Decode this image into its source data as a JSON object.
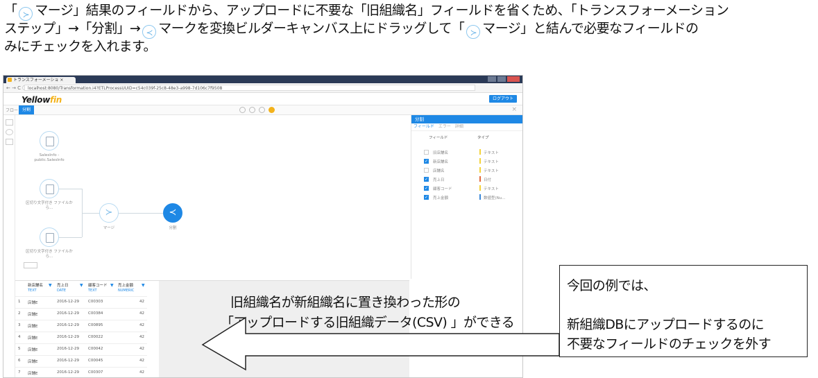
{
  "instruction": {
    "line1_a": "「",
    "line1_b": "マージ」結果のフィールドから、アップロードに不要な「旧組織名」フィールドを省くため、「トランスフォーメーション",
    "line2_a": "ステップ」→「分割」→",
    "line2_b": "マークを変換ビルダーキャンバス上にドラッグして「",
    "line2_c": "マージ」と結んで必要なフィールドの",
    "line3": "みにチェックを入れます。",
    "merge_icon": "merge-icon",
    "split_icon": "split-icon"
  },
  "browser": {
    "tab_title": "トランスフォーメーショ ×",
    "url": "localhost:8080/Transformation.i4?ETLProcessUUID=c54c039f-25c8-48e3-a998-7d106c7f9508",
    "nav_label": "← → C ⓘ"
  },
  "app": {
    "logo_main": "Yellow",
    "logo_fin": "fin",
    "logout_label": "ログアウト",
    "toolbar_tab1": "フロー",
    "toolbar_tab2": "分割",
    "close_glyph": "×"
  },
  "canvas": {
    "nodes": {
      "source1_label": "SalesInfo - public.SalesInfo",
      "source2_label": "区切り文字付き ファイルから...",
      "source3_label": "区切り文字付き ファイルから...",
      "merge_label": "マージ",
      "split_label": "分割"
    }
  },
  "panel": {
    "title": "分割",
    "tabs": [
      "フィールド",
      "エラー",
      "詳細"
    ],
    "col_field": "フィールド",
    "col_type": "タイプ",
    "fields": [
      {
        "name": "旧店舗名",
        "type": "テキスト",
        "checked": false,
        "color": "#f3d33b"
      },
      {
        "name": "新店舗名",
        "type": "テキスト",
        "checked": true,
        "color": "#f3d33b"
      },
      {
        "name": "店舗名",
        "type": "テキスト",
        "checked": false,
        "color": "#f3d33b"
      },
      {
        "name": "売上日",
        "type": "日付",
        "checked": true,
        "color": "#e2683c"
      },
      {
        "name": "顧客コード",
        "type": "テキスト",
        "checked": true,
        "color": "#f3d33b"
      },
      {
        "name": "売上金額",
        "type": "数値型(Nu...",
        "checked": true,
        "color": "#3a87d8"
      }
    ]
  },
  "grid": {
    "headers": [
      {
        "name": "新店舗名",
        "type": "TEXT"
      },
      {
        "name": "売上日",
        "type": "DATE"
      },
      {
        "name": "顧客コード",
        "type": "TEXT"
      },
      {
        "name": "売上金額",
        "type": "NUMERIC"
      }
    ],
    "rows": [
      [
        "1",
        "店舗E",
        "2016-12-29",
        "C00303",
        "42"
      ],
      [
        "2",
        "店舗E",
        "2016-12-29",
        "C00384",
        "42"
      ],
      [
        "3",
        "店舗E",
        "2016-12-29",
        "C00895",
        "42"
      ],
      [
        "4",
        "店舗E",
        "2016-12-29",
        "C00022",
        "42"
      ],
      [
        "5",
        "店舗E",
        "2016-12-29",
        "C00042",
        "42"
      ],
      [
        "6",
        "店舗E",
        "2016-12-29",
        "C00045",
        "42"
      ],
      [
        "7",
        "店舗E",
        "2016-12-29",
        "C00307",
        "42"
      ]
    ]
  },
  "callout": {
    "line1": "旧組織名が新組織名に置き換わった形の",
    "line2": "「アップロードする旧組織データ(CSV) 」ができる"
  },
  "note_box": {
    "line1": "今回の例では、",
    "line2": "新組織DBにアップロードするのに",
    "line3": "不要なフィールドのチェックを外す"
  }
}
